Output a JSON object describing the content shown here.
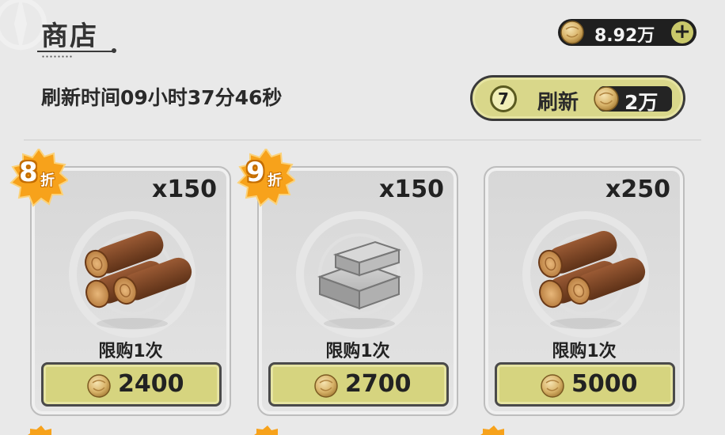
{
  "header": {
    "title": "商店",
    "currency_amount": "8.92万",
    "refresh_time_text": "刷新时间09小时37分46秒",
    "refresh_button": {
      "count": "7",
      "label": "刷新",
      "cost": "2万"
    }
  },
  "items": [
    {
      "badge_number": "8",
      "badge_suffix": "折",
      "quantity": "x150",
      "icon": "wood-logs-icon",
      "limit": "限购1次",
      "price": "2400"
    },
    {
      "badge_number": "9",
      "badge_suffix": "折",
      "quantity": "x150",
      "icon": "stone-bricks-icon",
      "limit": "限购1次",
      "price": "2700"
    },
    {
      "quantity": "x250",
      "icon": "wood-logs-icon",
      "limit": "限购1次",
      "price": "5000"
    }
  ],
  "colors": {
    "background": "#e9e9e9",
    "button_fill": "#d6d47f",
    "badge_orange": "#f7a21b",
    "dark_pill": "#1f1f1f"
  }
}
